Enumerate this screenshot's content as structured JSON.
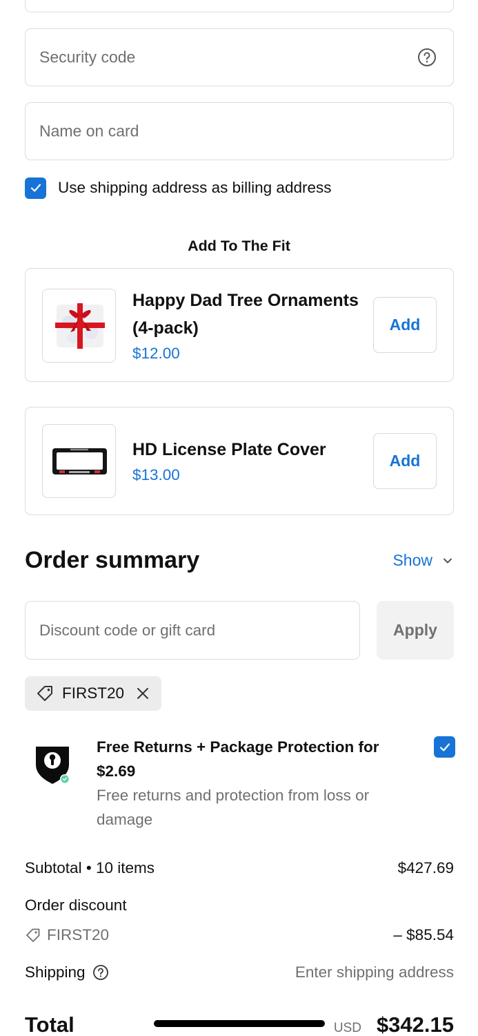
{
  "payment": {
    "security_code_placeholder": "Security code",
    "name_on_card_placeholder": "Name on card",
    "use_shipping_label": "Use shipping address as billing address",
    "use_shipping_checked": true
  },
  "upsell": {
    "title": "Add To The Fit",
    "products": [
      {
        "name": "Happy Dad Tree Ornaments (4-pack)",
        "price": "$12.00",
        "add_label": "Add"
      },
      {
        "name": "HD License Plate Cover",
        "price": "$13.00",
        "add_label": "Add"
      }
    ]
  },
  "summary": {
    "title": "Order summary",
    "show_label": "Show",
    "discount_placeholder": "Discount code or gift card",
    "apply_label": "Apply",
    "applied_code": "FIRST20",
    "protection": {
      "title": "Free Returns + Package Protection for $2.69",
      "description": "Free returns and protection from loss or damage",
      "checked": true
    },
    "subtotal_label": "Subtotal • 10 items",
    "subtotal_value": "$427.69",
    "order_discount_label": "Order discount",
    "discount_code": "FIRST20",
    "discount_value": "– $85.54",
    "shipping_label": "Shipping",
    "shipping_value": "Enter shipping address",
    "total_label": "Total",
    "currency": "USD",
    "total_value": "$342.15"
  },
  "colors": {
    "accent": "#1773d6",
    "border": "#dcdcdc",
    "muted_text": "#707070",
    "chip_bg": "#ececec"
  }
}
